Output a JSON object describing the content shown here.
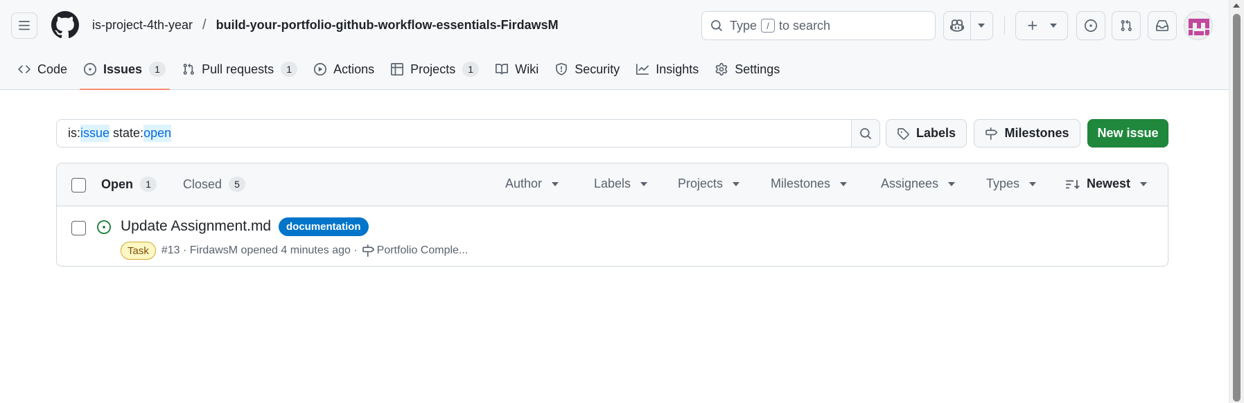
{
  "header": {
    "owner": "is-project-4th-year",
    "separator": "/",
    "repo": "build-your-portfolio-github-workflow-essentials-FirdawsM",
    "search": {
      "prefix": "Type",
      "key": "/",
      "suffix": "to search"
    }
  },
  "nav": {
    "code": "Code",
    "issues": "Issues",
    "issues_count": "1",
    "pulls": "Pull requests",
    "pulls_count": "1",
    "actions": "Actions",
    "projects": "Projects",
    "projects_count": "1",
    "wiki": "Wiki",
    "security": "Security",
    "insights": "Insights",
    "settings": "Settings"
  },
  "filter": {
    "q_is": "is:",
    "q_issue": "issue",
    "q_state": " state:",
    "q_open": "open",
    "labels_btn": "Labels",
    "milestones_btn": "Milestones",
    "new_issue_btn": "New issue"
  },
  "list": {
    "open_label": "Open",
    "open_count": "1",
    "closed_label": "Closed",
    "closed_count": "5",
    "filters": {
      "author": "Author",
      "labels": "Labels",
      "projects": "Projects",
      "milestones": "Milestones",
      "assignees": "Assignees",
      "types": "Types",
      "sort": "Newest"
    },
    "issues": [
      {
        "title": "Update Assignment.md",
        "label": "documentation",
        "type": "Task",
        "meta": "#13 · FirdawsM opened 4 minutes ago ·",
        "milestone": "Portfolio Comple..."
      }
    ]
  },
  "colors": {
    "accent": "#0969da",
    "primary_button": "#1f883d",
    "label_documentation": "#0075ca",
    "open_state": "#1a7f37",
    "active_tab_underline": "#fd8c73"
  }
}
